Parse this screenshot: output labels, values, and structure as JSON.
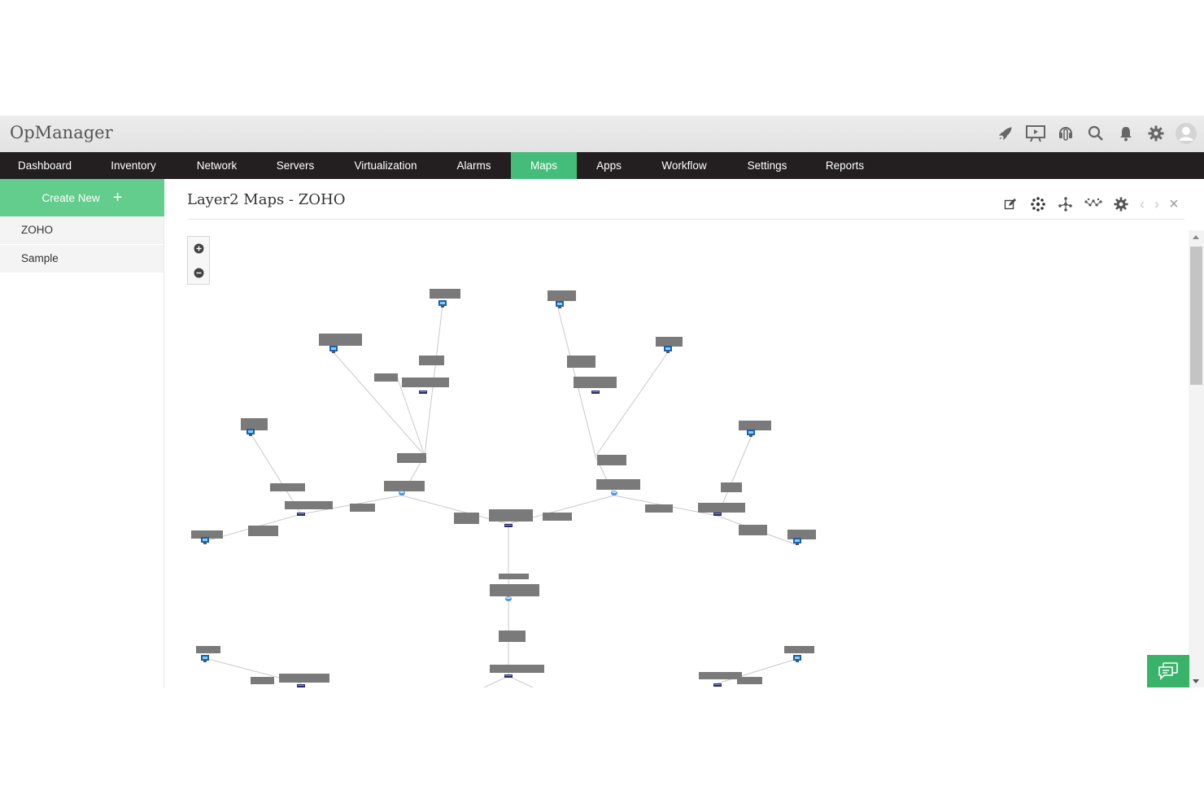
{
  "app": {
    "name": "OpManager"
  },
  "header_icons": [
    "rocket-icon",
    "presentation-icon",
    "headset-icon",
    "search-icon",
    "bell-icon",
    "settings-icon",
    "user-avatar-icon"
  ],
  "nav": {
    "items": [
      {
        "label": "Dashboard",
        "active": false
      },
      {
        "label": "Inventory",
        "active": false
      },
      {
        "label": "Network",
        "active": false
      },
      {
        "label": "Servers",
        "active": false
      },
      {
        "label": "Virtualization",
        "active": false
      },
      {
        "label": "Alarms",
        "active": false
      },
      {
        "label": "Maps",
        "active": true
      },
      {
        "label": "Apps",
        "active": false
      },
      {
        "label": "Workflow",
        "active": false
      },
      {
        "label": "Settings",
        "active": false
      },
      {
        "label": "Reports",
        "active": false
      }
    ]
  },
  "sidebar": {
    "create_label": "Create New",
    "create_icon": "plus-icon",
    "maps": [
      {
        "label": "ZOHO"
      },
      {
        "label": "Sample"
      }
    ]
  },
  "main": {
    "title": "Layer2 Maps - ZOHO",
    "toolbar_icons": [
      "edit-icon",
      "layout-radial-icon",
      "layout-hierarchy-icon",
      "layout-mesh-icon",
      "map-settings-icon",
      "previous-icon",
      "next-icon",
      "close-icon"
    ],
    "zoom_icons": [
      "zoom-in-icon",
      "zoom-out-icon"
    ]
  },
  "chat_icon": "chat-icon",
  "colors": {
    "nav_bg": "#231f20",
    "nav_active": "#45bd7a",
    "create_button": "#62cd8c",
    "chat_button": "#39b36a",
    "node_label": "#7a7a7a",
    "link": "#c9c9c9"
  }
}
